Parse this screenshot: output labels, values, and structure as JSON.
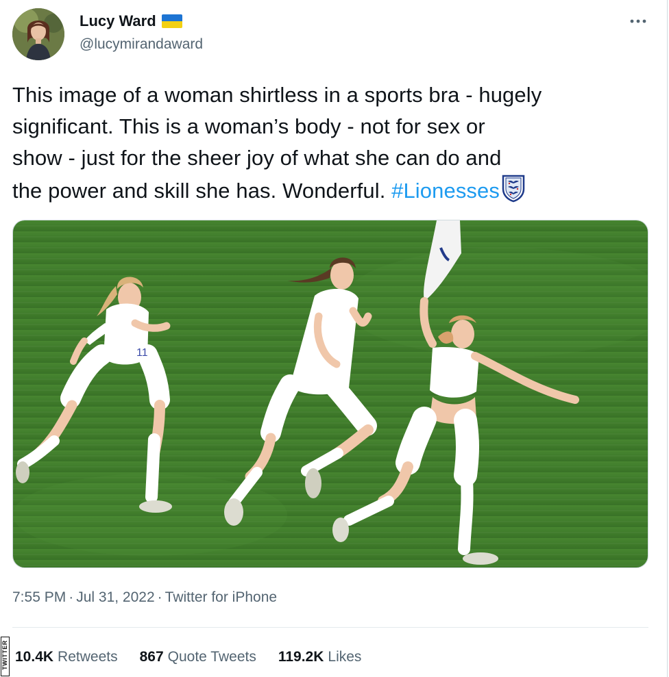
{
  "author": {
    "name": "Lucy Ward",
    "handle": "@lucymirandaward",
    "flag_icon": "ukraine-flag-icon",
    "flag_colors": [
      "#1d74d3",
      "#f3d012"
    ]
  },
  "more_icon": "more-horizontal-icon",
  "tweet": {
    "line1": "This image of a woman shirtless in a sports bra - hugely",
    "line2": "significant. This is a woman’s body - not for sex or",
    "line3": "show - just for the sheer joy  of what she can do and",
    "line4_prefix": "the power and skill she has. Wonderful. ",
    "hashtag": "#Lionesses",
    "emoji_icon": "england-crest-icon"
  },
  "meta": {
    "time": "7:55 PM",
    "date": "Jul 31, 2022",
    "source": "Twitter for iPhone",
    "separator": "·"
  },
  "stats": [
    {
      "value": "10.4K",
      "label": "Retweets"
    },
    {
      "value": "867",
      "label": "Quote Tweets"
    },
    {
      "value": "119.2K",
      "label": "Likes"
    }
  ],
  "watermark": "TWITTER",
  "colors": {
    "text": "#0f1419",
    "secondary": "#536471",
    "link": "#1d9bf0",
    "border": "#cfd9de",
    "pitch": "#3f7a2e"
  }
}
